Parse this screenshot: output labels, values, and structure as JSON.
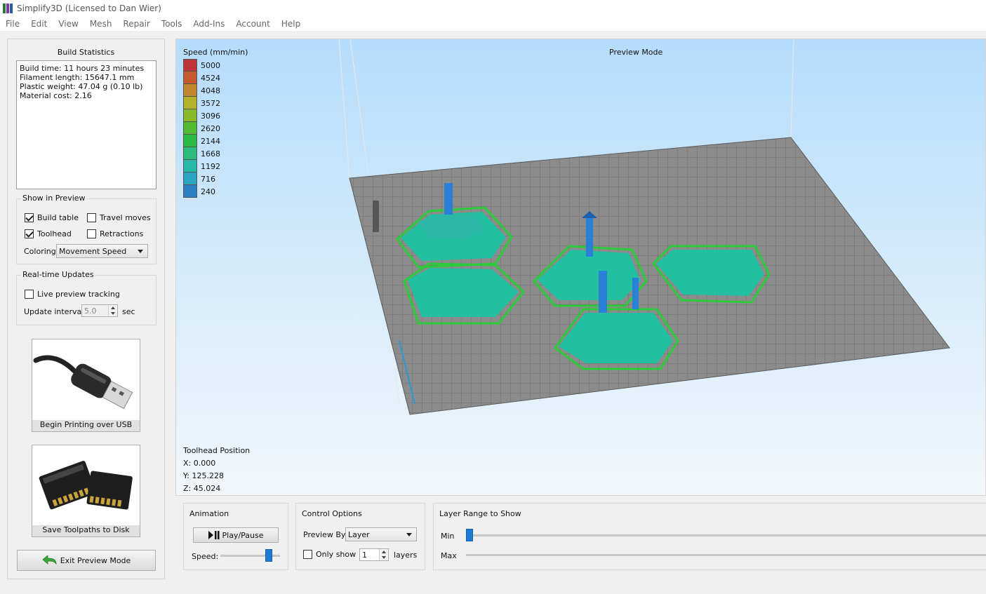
{
  "window": {
    "title": "Simplify3D (Licensed to Dan Wier)",
    "menu": [
      "File",
      "Edit",
      "View",
      "Mesh",
      "Repair",
      "Tools",
      "Add-Ins",
      "Account",
      "Help"
    ]
  },
  "build_statistics": {
    "title": "Build Statistics",
    "lines": [
      "Build time: 11 hours 23 minutes",
      "Filament length: 15647.1 mm",
      "Plastic weight: 47.04 g (0.10 lb)",
      "Material cost: 2.16"
    ]
  },
  "show_in_preview": {
    "title": "Show in Preview",
    "build_table": {
      "label": "Build table",
      "checked": true
    },
    "travel_moves": {
      "label": "Travel moves",
      "checked": false
    },
    "toolhead": {
      "label": "Toolhead",
      "checked": true
    },
    "retractions": {
      "label": "Retractions",
      "checked": false
    },
    "coloring_label": "Coloring",
    "coloring_value": "Movement Speed"
  },
  "realtime": {
    "title": "Real-time Updates",
    "live_preview": {
      "label": "Live preview tracking",
      "checked": false
    },
    "interval_label": "Update interval",
    "interval_value": "5.0",
    "interval_unit": "sec"
  },
  "actions": {
    "usb_label": "Begin Printing over USB",
    "disk_label": "Save Toolpaths to Disk",
    "exit_label": "Exit Preview Mode"
  },
  "viewport": {
    "legend_title": "Speed (mm/min)",
    "legend": [
      {
        "value": "5000",
        "color": "#c0333a"
      },
      {
        "value": "4524",
        "color": "#c45a2e"
      },
      {
        "value": "4048",
        "color": "#c2872c"
      },
      {
        "value": "3572",
        "color": "#b3b22a"
      },
      {
        "value": "3096",
        "color": "#87bb2c"
      },
      {
        "value": "2620",
        "color": "#52bb33"
      },
      {
        "value": "2144",
        "color": "#2bbb45"
      },
      {
        "value": "1668",
        "color": "#2bbb7c"
      },
      {
        "value": "1192",
        "color": "#27b8a6"
      },
      {
        "value": "716",
        "color": "#2aa6c3"
      },
      {
        "value": "240",
        "color": "#2f7fc7"
      }
    ],
    "mode_label": "Preview Mode",
    "toolhead_title": "Toolhead Position",
    "x": "X: 0.000",
    "y": "Y: 125.228",
    "z": "Z: 45.024"
  },
  "animation": {
    "title": "Animation",
    "play_label": "Play/Pause",
    "speed_label": "Speed:",
    "speed_level": 0.85
  },
  "control": {
    "title": "Control Options",
    "preview_by_label": "Preview By",
    "preview_by_value": "Layer",
    "only_show": {
      "label": "Only show",
      "checked": false
    },
    "layers_value": "1",
    "layers_unit": "layers"
  },
  "layer_range": {
    "title": "Layer Range to Show",
    "min_label": "Min",
    "max_label": "Max",
    "min_level": 0.0
  }
}
